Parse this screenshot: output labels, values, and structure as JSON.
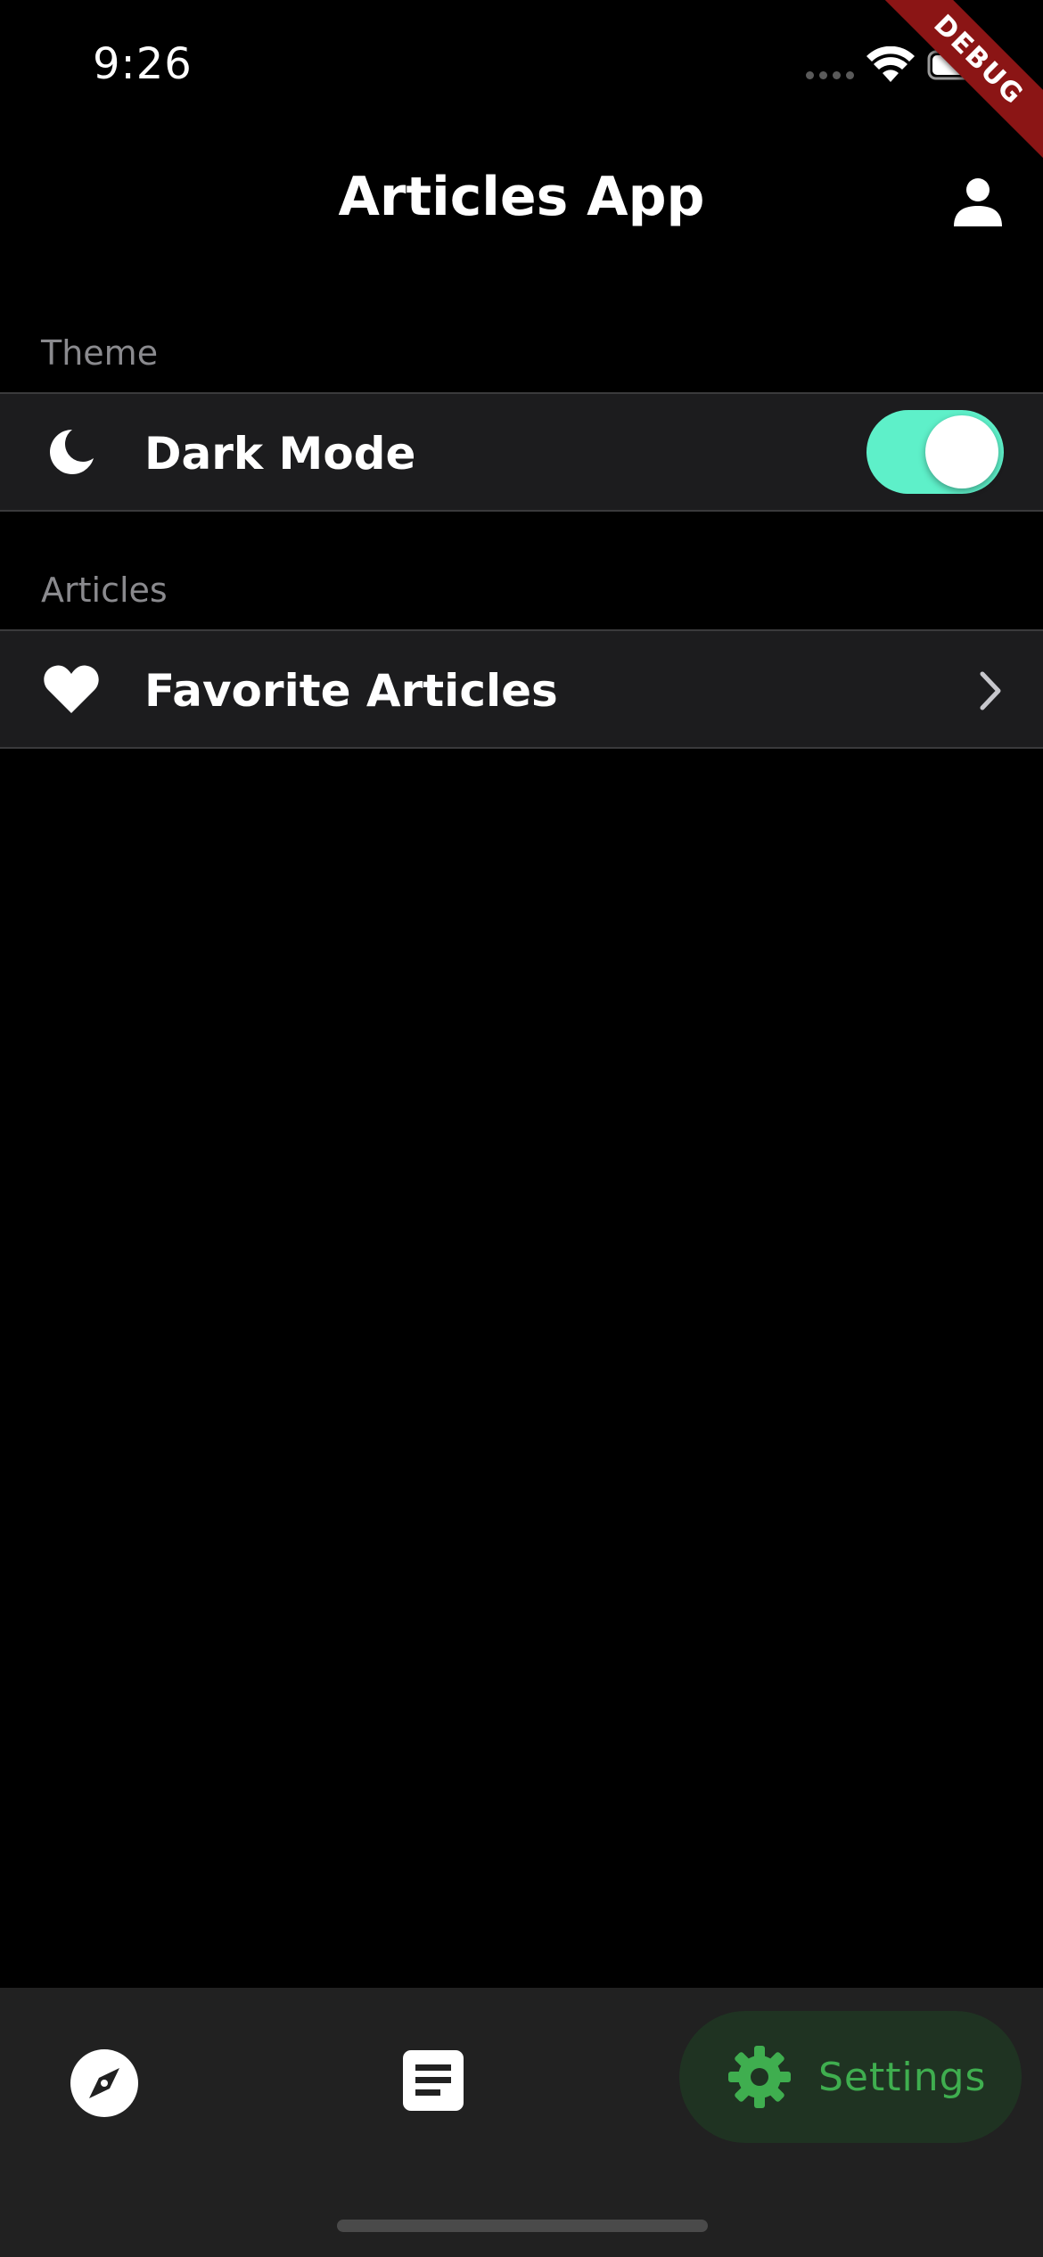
{
  "status_bar": {
    "time": "9:26"
  },
  "debug_banner": "DEBUG",
  "app_bar": {
    "title": "Articles App",
    "profile_icon": "person-icon"
  },
  "sections": [
    {
      "header": "Theme",
      "tiles": [
        {
          "icon": "moon-icon",
          "label": "Dark Mode",
          "toggle": {
            "on": true,
            "active_color": "#5ef0c9"
          }
        }
      ]
    },
    {
      "header": "Articles",
      "tiles": [
        {
          "icon": "heart-icon",
          "label": "Favorite Articles",
          "trailing": "chevron-right-icon"
        }
      ]
    }
  ],
  "bottom_nav": {
    "items": [
      {
        "icon": "compass-icon",
        "label": "",
        "selected": false
      },
      {
        "icon": "article-icon",
        "label": "",
        "selected": false
      },
      {
        "icon": "gear-icon",
        "label": "Settings",
        "selected": true
      }
    ],
    "selected_color": "#3fae4f"
  },
  "colors": {
    "background": "#000000",
    "tile_background": "#1c1c1e",
    "nav_background": "#212121",
    "section_header": "#8a8a8e"
  }
}
